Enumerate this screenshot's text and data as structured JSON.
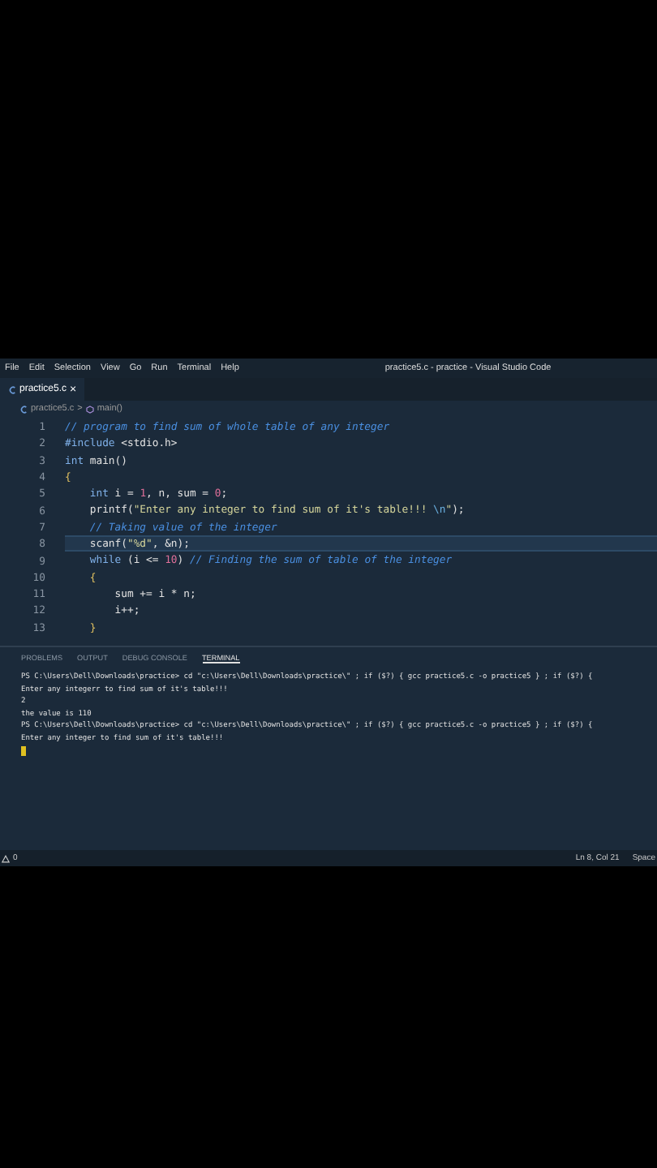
{
  "menu": [
    "File",
    "Edit",
    "Selection",
    "View",
    "Go",
    "Run",
    "Terminal",
    "Help"
  ],
  "window": {
    "title": "practice5.c - practice - Visual Studio Code"
  },
  "tabs": [
    {
      "label": "practice5.c",
      "selected": true,
      "close": "×"
    }
  ],
  "breadcrumb": {
    "file": "practice5.c",
    "separator": ">",
    "symbol": "main()"
  },
  "code": [
    {
      "num": "1",
      "current": false,
      "tokens": [
        {
          "t": "// program to find sum of whole table of any integer",
          "kind": "comment"
        }
      ]
    },
    {
      "num": "2",
      "current": false,
      "tokens": [
        {
          "t": "#include",
          "kind": "keyword"
        },
        {
          "t": " <stdio.h>",
          "kind": "plain"
        }
      ]
    },
    {
      "num": "3",
      "current": false,
      "tokens": [
        {
          "t": "int",
          "kind": "keyword"
        },
        {
          "t": " main()",
          "kind": "plain"
        }
      ]
    },
    {
      "num": "4",
      "current": false,
      "tokens": [
        {
          "t": "{",
          "kind": "brace"
        }
      ]
    },
    {
      "num": "5",
      "current": false,
      "tokens": [
        {
          "t": "    int",
          "kind": "keyword"
        },
        {
          "t": " i = ",
          "kind": "plain"
        },
        {
          "t": "1",
          "kind": "number"
        },
        {
          "t": ", n, sum = ",
          "kind": "plain"
        },
        {
          "t": "0",
          "kind": "number"
        },
        {
          "t": ";",
          "kind": "plain"
        }
      ]
    },
    {
      "num": "6",
      "current": false,
      "tokens": [
        {
          "t": "    printf(",
          "kind": "plain"
        },
        {
          "t": "\"Enter any integer to find sum of it's table!!! ",
          "kind": "string"
        },
        {
          "t": "\\n",
          "kind": "escape"
        },
        {
          "t": "\"",
          "kind": "string"
        },
        {
          "t": ");",
          "kind": "plain"
        }
      ]
    },
    {
      "num": "7",
      "current": false,
      "tokens": [
        {
          "t": "    // Taking value of the integer",
          "kind": "comment"
        }
      ]
    },
    {
      "num": "8",
      "current": true,
      "tokens": [
        {
          "t": "    scanf(",
          "kind": "plain"
        },
        {
          "t": "\"%d\"",
          "kind": "string"
        },
        {
          "t": ", &n);",
          "kind": "plain"
        }
      ]
    },
    {
      "num": "9",
      "current": false,
      "tokens": [
        {
          "t": "    while",
          "kind": "keyword"
        },
        {
          "t": " (i <= ",
          "kind": "plain"
        },
        {
          "t": "10",
          "kind": "number"
        },
        {
          "t": ") ",
          "kind": "plain"
        },
        {
          "t": "// Finding the sum of table of the integer",
          "kind": "comment"
        }
      ]
    },
    {
      "num": "10",
      "current": false,
      "tokens": [
        {
          "t": "    {",
          "kind": "brace"
        }
      ]
    },
    {
      "num": "11",
      "current": false,
      "tokens": [
        {
          "t": "        sum += i * n;",
          "kind": "plain"
        }
      ]
    },
    {
      "num": "12",
      "current": false,
      "tokens": [
        {
          "t": "        i++;",
          "kind": "plain"
        }
      ]
    },
    {
      "num": "13",
      "current": false,
      "tokens": [
        {
          "t": "    }",
          "kind": "brace"
        }
      ]
    }
  ],
  "panel_tabs": [
    {
      "label": "PROBLEMS",
      "selected": false
    },
    {
      "label": "OUTPUT",
      "selected": false
    },
    {
      "label": "DEBUG CONSOLE",
      "selected": false
    },
    {
      "label": "TERMINAL",
      "selected": true
    }
  ],
  "terminal": [
    "PS C:\\Users\\Dell\\Downloads\\practice> cd \"c:\\Users\\Dell\\Downloads\\practice\\\" ; if ($?) { gcc practice5.c -o practice5 } ; if ($?) {",
    "Enter any integerr to find sum of it's table!!!",
    "2",
    "the value is 110",
    "PS C:\\Users\\Dell\\Downloads\\practice> cd \"c:\\Users\\Dell\\Downloads\\practice\\\" ; if ($?) { gcc practice5.c -o practice5 } ; if ($?) {",
    "Enter any integer to find sum of it's table!!!"
  ],
  "status_bar": {
    "warnings": "0",
    "position": "Ln 8, Col 21",
    "indent": "Space"
  }
}
